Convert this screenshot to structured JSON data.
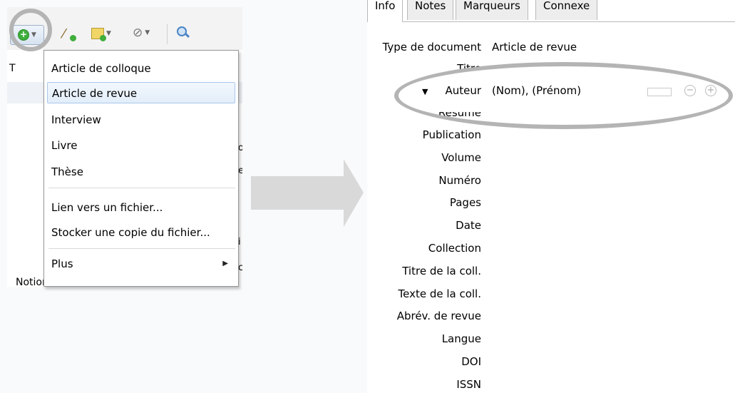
{
  "menu": {
    "items": [
      "Article de colloque",
      "Article de revue",
      "Interview",
      "Livre",
      "Thèse",
      "Lien vers un fichier...",
      "Stocker une copie du fichier...",
      "Plus"
    ],
    "selected_index": 1
  },
  "background_fragments": {
    "letter_t": "T",
    "right_fragments": [
      "o",
      "e",
      "i",
      "c"
    ],
    "bottom_item": "Notion d'aménagement des forêts"
  },
  "info_pane": {
    "tabs": [
      "Info",
      "Notes",
      "Marqueurs",
      "Connexe"
    ],
    "active_tab": "Info",
    "fields": {
      "type_label": "Type de document",
      "type_value": "Article de revue",
      "titre": "Titre",
      "auteur": "Auteur",
      "auteur_value": "(Nom), (Prénom)",
      "resume": "Résumé",
      "rest": [
        "Publication",
        "Volume",
        "Numéro",
        "Pages",
        "Date",
        "Collection",
        "Titre de la coll.",
        "Texte de la coll.",
        "Abrév. de revue",
        "Langue",
        "DOI",
        "ISSN"
      ]
    }
  },
  "icons": {
    "new_item": "new-item-icon",
    "magic_wand": "magic-wand-icon",
    "new_note": "new-note-icon",
    "attach": "paperclip-icon",
    "search": "search-icon"
  },
  "colors": {
    "highlight": "#b4b4b4",
    "selection": "#e3eefa",
    "arrow": "#d9d9d9"
  }
}
